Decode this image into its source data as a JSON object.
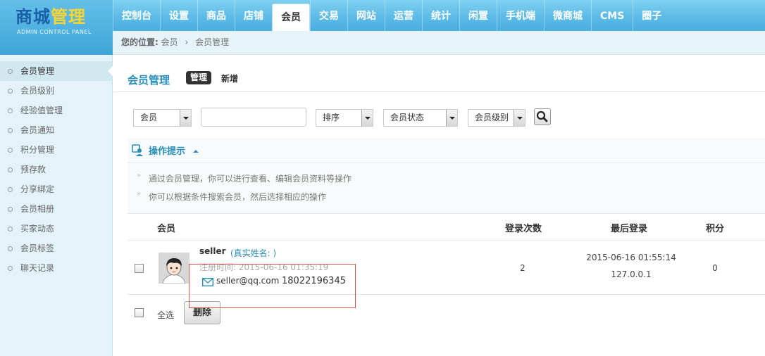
{
  "logo": {
    "title_a": "商城",
    "title_b": "管理",
    "subtitle": "ADMIN CONTROL PANEL"
  },
  "nav": [
    "控制台",
    "设置",
    "商品",
    "店铺",
    "会员",
    "交易",
    "网站",
    "运营",
    "统计",
    "闲置",
    "手机端",
    "微商城",
    "CMS",
    "圈子"
  ],
  "nav_active": "会员",
  "breadcrumb": {
    "label": "您的位置:",
    "root": "会员",
    "sep": "›",
    "current": "会员管理"
  },
  "sidebar": [
    "会员管理",
    "会员级别",
    "经验值管理",
    "会员通知",
    "积分管理",
    "预存款",
    "分享绑定",
    "会员相册",
    "买家动态",
    "会员标签",
    "聊天记录"
  ],
  "page": {
    "title": "会员管理",
    "tab_manage": "管理",
    "tab_add": "新增"
  },
  "filter": {
    "field": "会员",
    "keyword": "",
    "sort": "排序",
    "status": "会员状态",
    "level": "会员级别"
  },
  "tips": {
    "title": "操作提示",
    "lines": [
      "通过会员管理，你可以进行查看、编辑会员资料等操作",
      "你可以根据条件搜索会员，然后选择相应的操作"
    ]
  },
  "table": {
    "headers": {
      "member": "会员",
      "logins": "登录次数",
      "last_login": "最后登录",
      "points": "积分"
    },
    "rows": [
      {
        "name": "seller",
        "real_name": "(真实姓名: )",
        "reg_time": "注册时间: 2015-06-16 01:35:19",
        "email": "seller@qq.com",
        "phone": "18022196345",
        "logins": "2",
        "last_login_time": "2015-06-16 01:55:14",
        "last_login_ip": "127.0.0.1",
        "points": "0"
      }
    ]
  },
  "footer": {
    "select_all": "全选",
    "delete": "删除"
  }
}
